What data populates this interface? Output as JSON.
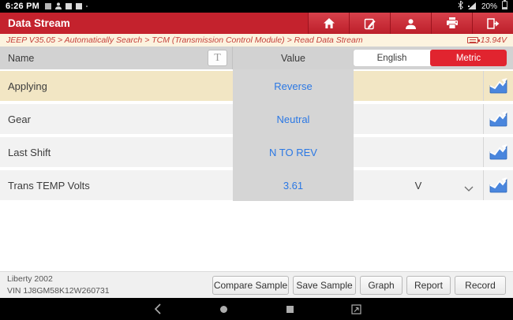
{
  "status_bar": {
    "time": "6:26 PM",
    "battery_percent": "20%"
  },
  "title_bar": {
    "title": "Data Stream"
  },
  "breadcrumb": {
    "path": "JEEP V35.05 > Automatically Search > TCM (Transmission Control Module) > Read Data Stream",
    "voltage": "13.94V"
  },
  "table": {
    "header": {
      "name": "Name",
      "text_tool": "T",
      "value": "Value"
    },
    "unit_toggle": {
      "english": "English",
      "metric": "Metric",
      "selected": "Metric"
    },
    "rows": [
      {
        "name": "Applying",
        "value": "Reverse",
        "unit": ""
      },
      {
        "name": "Gear",
        "value": "Neutral",
        "unit": ""
      },
      {
        "name": "Last Shift",
        "value": "N TO REV",
        "unit": ""
      },
      {
        "name": "Trans TEMP Volts",
        "value": "3.61",
        "unit": "V"
      }
    ]
  },
  "footer": {
    "vehicle_model": "Liberty 2002",
    "vin": "VIN 1J8GM58K12W260731",
    "buttons": {
      "compare": "Compare Sample",
      "save": "Save Sample",
      "graph": "Graph",
      "report": "Report",
      "record": "Record"
    }
  },
  "colors": {
    "accent_red": "#c4222d",
    "metric_red": "#e1242f",
    "value_blue": "#2b78e4",
    "row_highlight": "#f2e6c4"
  }
}
